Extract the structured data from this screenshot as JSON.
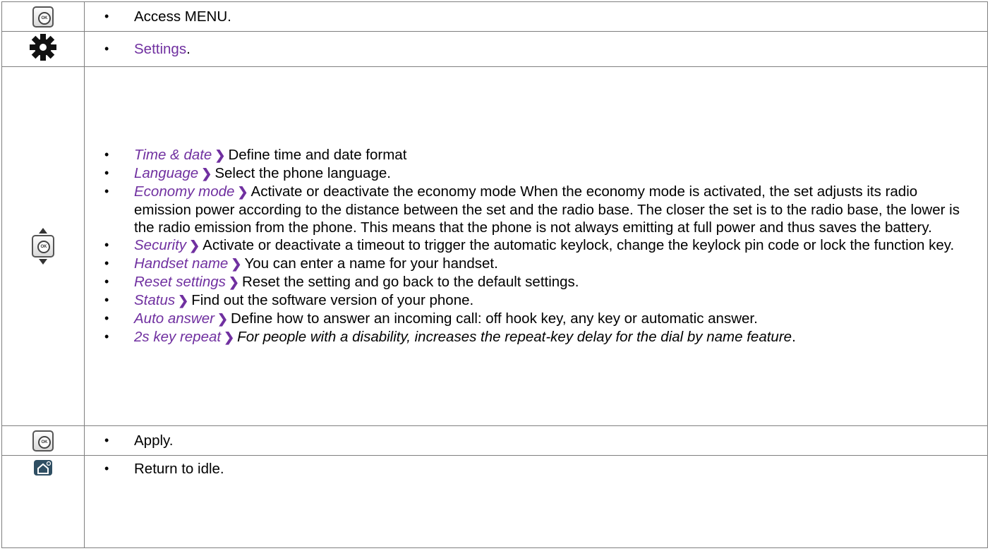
{
  "rows": [
    {
      "icon": "ok-key-icon",
      "text": "Access MENU."
    },
    {
      "icon": "gear-icon",
      "text": "Settings",
      "text_suffix": "."
    },
    {
      "icon": "navigator-key-icon",
      "items": [
        {
          "term": "Time & date",
          "desc": "Define time and date format"
        },
        {
          "term": "Language",
          "desc": "Select the phone language."
        },
        {
          "term": "Economy mode",
          "desc": "Activate or deactivate the economy mode When the economy mode is activated, the set adjusts its radio emission power according to the distance between the set and the radio base. The closer the set is to the radio base, the lower is the radio emission from the phone. This means that the phone is not always emitting at full power and thus saves the battery."
        },
        {
          "term": "Security",
          "desc": "Activate or deactivate a timeout to trigger the automatic keylock, change the keylock pin code or lock the function key."
        },
        {
          "term": "Handset name",
          "desc": "You can enter a name for your handset."
        },
        {
          "term": "Reset settings",
          "desc": "Reset the setting and go back to the default settings."
        },
        {
          "term": "Status",
          "desc": "Find out the software version of your phone."
        },
        {
          "term": "Auto answer",
          "desc": "Define how to answer an incoming call: off hook key, any key or automatic answer."
        },
        {
          "term": "2s key repeat",
          "desc": "For people with a disability, increases the repeat-key delay for the dial by name feature",
          "desc_suffix": "."
        }
      ]
    },
    {
      "icon": "ok-key-icon",
      "text": "Apply."
    },
    {
      "icon": "home-key-icon",
      "text": "Return to idle."
    }
  ],
  "separator": "❯",
  "colors": {
    "accent": "#7030a0",
    "border": "#7f7f7f",
    "icon_dark": "#2f4f63"
  }
}
